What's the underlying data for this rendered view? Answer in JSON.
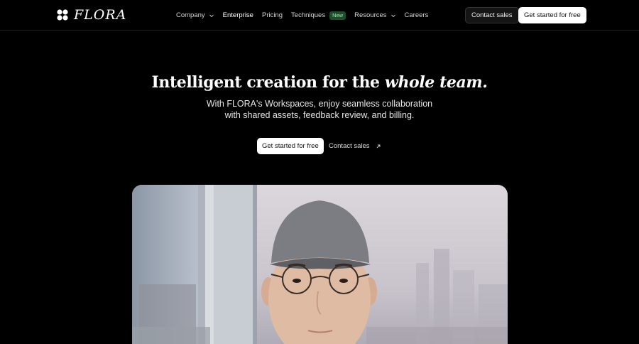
{
  "nav": {
    "brand": "FLORA",
    "links": [
      {
        "label": "Company",
        "has_dropdown": true
      },
      {
        "label": "Enterprise",
        "active": true
      },
      {
        "label": "Pricing"
      },
      {
        "label": "Techniques",
        "badge": "New"
      },
      {
        "label": "Resources",
        "has_dropdown": true
      },
      {
        "label": "Careers"
      }
    ],
    "contact_label": "Contact sales",
    "get_started_label": "Get started for free"
  },
  "hero": {
    "headline_plain": "Intelligent creation for the",
    "headline_italic": "whole team.",
    "sub_line1": "With FLORA's Workspaces, enjoy seamless collaboration",
    "sub_line2": "with shared assets, feedback review, and billing.",
    "primary_cta": "Get started for free",
    "secondary_cta": "Contact sales"
  },
  "colors": {
    "background": "#000000",
    "badge_bg": "#1f4d2b",
    "badge_text": "#9ce3ae"
  },
  "icons": [
    "flora-logo-icon",
    "chevron-down-icon",
    "arrow-up-right-icon"
  ]
}
